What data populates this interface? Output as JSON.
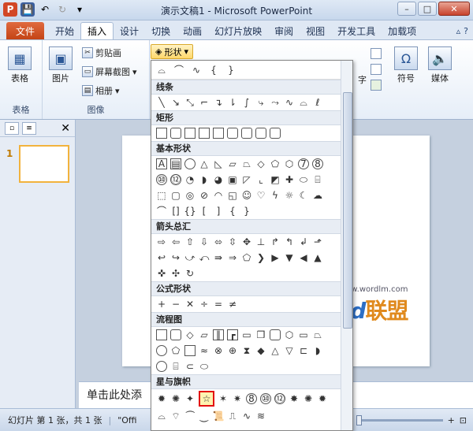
{
  "window": {
    "title": "演示文稿1 - Microsoft PowerPoint"
  },
  "qat": {
    "app": "P",
    "save": "💾",
    "undo": "↶",
    "redo": "↻",
    "more": "▾"
  },
  "tabs": [
    {
      "label": "文件"
    },
    {
      "label": "开始"
    },
    {
      "label": "插入"
    },
    {
      "label": "设计"
    },
    {
      "label": "切换"
    },
    {
      "label": "动画"
    },
    {
      "label": "幻灯片放映"
    },
    {
      "label": "审阅"
    },
    {
      "label": "视图"
    },
    {
      "label": "开发工具"
    },
    {
      "label": "加载项"
    }
  ],
  "ribbon": {
    "table": {
      "label": "表格",
      "group": "表格"
    },
    "image": {
      "picture": "图片",
      "clipart": "剪贴画",
      "screenshot": "屏幕截图",
      "album": "相册",
      "group": "图像"
    },
    "shapes": {
      "label": "形状"
    },
    "right": {
      "wordart": "字",
      "symbol": "符号",
      "media": "媒体",
      "symbol_icon": "Ω"
    }
  },
  "gallery": {
    "sections": [
      {
        "title": "线条"
      },
      {
        "title": "矩形"
      },
      {
        "title": "基本形状"
      },
      {
        "title": "箭头总汇"
      },
      {
        "title": "公式形状"
      },
      {
        "title": "流程图"
      },
      {
        "title": "星与旗帜"
      }
    ]
  },
  "notes": {
    "text": "单击此处添"
  },
  "status": {
    "slide": "幻灯片 第 1 张，共 1 张",
    "theme": "\"Offi"
  },
  "thumbnail": {
    "number": "1"
  },
  "watermark": {
    "url": "www.wordlm.com",
    "logo_word": "Word",
    "logo_cn": "联盟"
  },
  "colors": {
    "file_tab": "#c44416",
    "selected_outline": "#e31010",
    "accent": "#2b5796"
  }
}
